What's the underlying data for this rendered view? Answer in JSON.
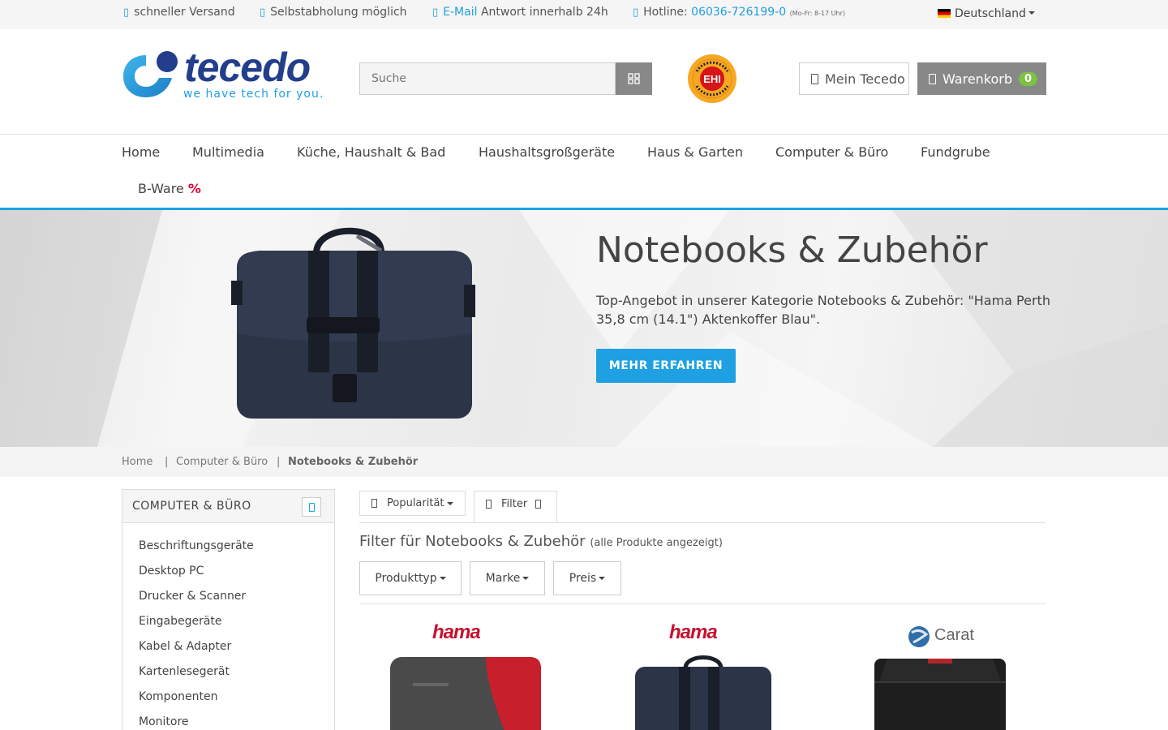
{
  "topbar": {
    "shipping": "schneller Versand",
    "pickup": "Selbstabholung möglich",
    "email_link": "E-Mail",
    "email_rest": " Antwort innerhalb 24h",
    "hotline_label": "Hotline: ",
    "hotline_number": "06036-726199-0",
    "hotline_hours": "(Mo-Fr: 8-17 Uhr)",
    "language": "Deutschland"
  },
  "header": {
    "logo_text": "tecedo",
    "logo_tagline": "we have tech for you.",
    "search_placeholder": "Suche",
    "trust_badge": "EHI",
    "account_label": "Mein Tecedo",
    "cart_label": "Warenkorb",
    "cart_count": "0"
  },
  "nav": {
    "items": [
      "Home",
      "Multimedia",
      "Küche, Haushalt & Bad",
      "Haushaltsgroßgeräte",
      "Haus & Garten",
      "Computer & Büro",
      "Fundgrube"
    ],
    "bware_label": "B-Ware ",
    "bware_symbol": "%"
  },
  "hero": {
    "title": "Notebooks & Zubehör",
    "text": "Top-Angebot in unserer Kategorie Notebooks & Zubehör: \"Hama Perth 35,8 cm (14.1\") Aktenkoffer Blau\".",
    "button": "MEHR ERFAHREN"
  },
  "breadcrumb": {
    "items": [
      "Home",
      "Computer & Büro",
      "Notebooks & Zubehör"
    ],
    "separator": "|"
  },
  "sidebar": {
    "title": "COMPUTER & BÜRO",
    "items": [
      "Beschriftungsgeräte",
      "Desktop PC",
      "Drucker & Scanner",
      "Eingabegeräte",
      "Kabel & Adapter",
      "Kartenlesegerät",
      "Komponenten",
      "Monitore"
    ]
  },
  "content": {
    "sort_label": "Popularität",
    "filter_tab": "Filter",
    "filter_title": "Filter für Notebooks & Zubehör",
    "filter_subtitle": "(alle Produkte angezeigt)",
    "filters": [
      "Produkttyp",
      "Marke",
      "Preis"
    ]
  },
  "products": [
    {
      "brand": "hama"
    },
    {
      "brand": "hama"
    },
    {
      "brand": "Carat"
    }
  ],
  "colors": {
    "accent": "#1ea0e2",
    "logo_blue": "#233e8b",
    "cart_badge": "#7dc242",
    "sale": "#e2003a",
    "hama_red": "#c8102e"
  }
}
